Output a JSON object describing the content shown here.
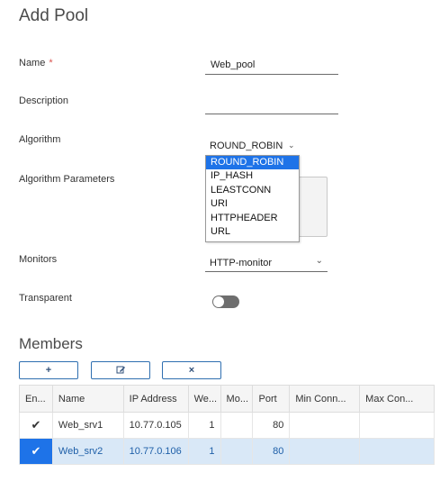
{
  "form": {
    "title": "Add Pool",
    "name_label": "Name",
    "required_mark": "*",
    "name_value": "Web_pool",
    "description_label": "Description",
    "description_value": "",
    "algorithm_label": "Algorithm",
    "algorithm_value": "ROUND_ROBIN",
    "algorithm_options": [
      "ROUND_ROBIN",
      "IP_HASH",
      "LEASTCONN",
      "URI",
      "HTTPHEADER",
      "URL"
    ],
    "algorithm_params_label": "Algorithm Parameters",
    "monitors_label": "Monitors",
    "monitors_value": "HTTP-monitor",
    "transparent_label": "Transparent",
    "transparent_on": false
  },
  "members": {
    "title": "Members",
    "toolbar": {
      "add_icon": "+",
      "edit_icon": "edit-icon",
      "delete_icon": "×"
    },
    "columns": [
      "En...",
      "Name",
      "IP Address",
      "We...",
      "Mo...",
      "Port",
      "Min Conn...",
      "Max Con..."
    ],
    "rows": [
      {
        "enabled": "✔",
        "name": "Web_srv1",
        "ip": "10.77.0.105",
        "weight": "1",
        "monitor_port": "",
        "port": "80",
        "min_conn": "",
        "max_conn": "",
        "selected": false
      },
      {
        "enabled": "✔",
        "name": "Web_srv2",
        "ip": "10.77.0.106",
        "weight": "1",
        "monitor_port": "",
        "port": "80",
        "min_conn": "",
        "max_conn": "",
        "selected": true
      }
    ]
  },
  "colors": {
    "accent": "#1e73e8",
    "selected_row": "#d9e8f7"
  }
}
